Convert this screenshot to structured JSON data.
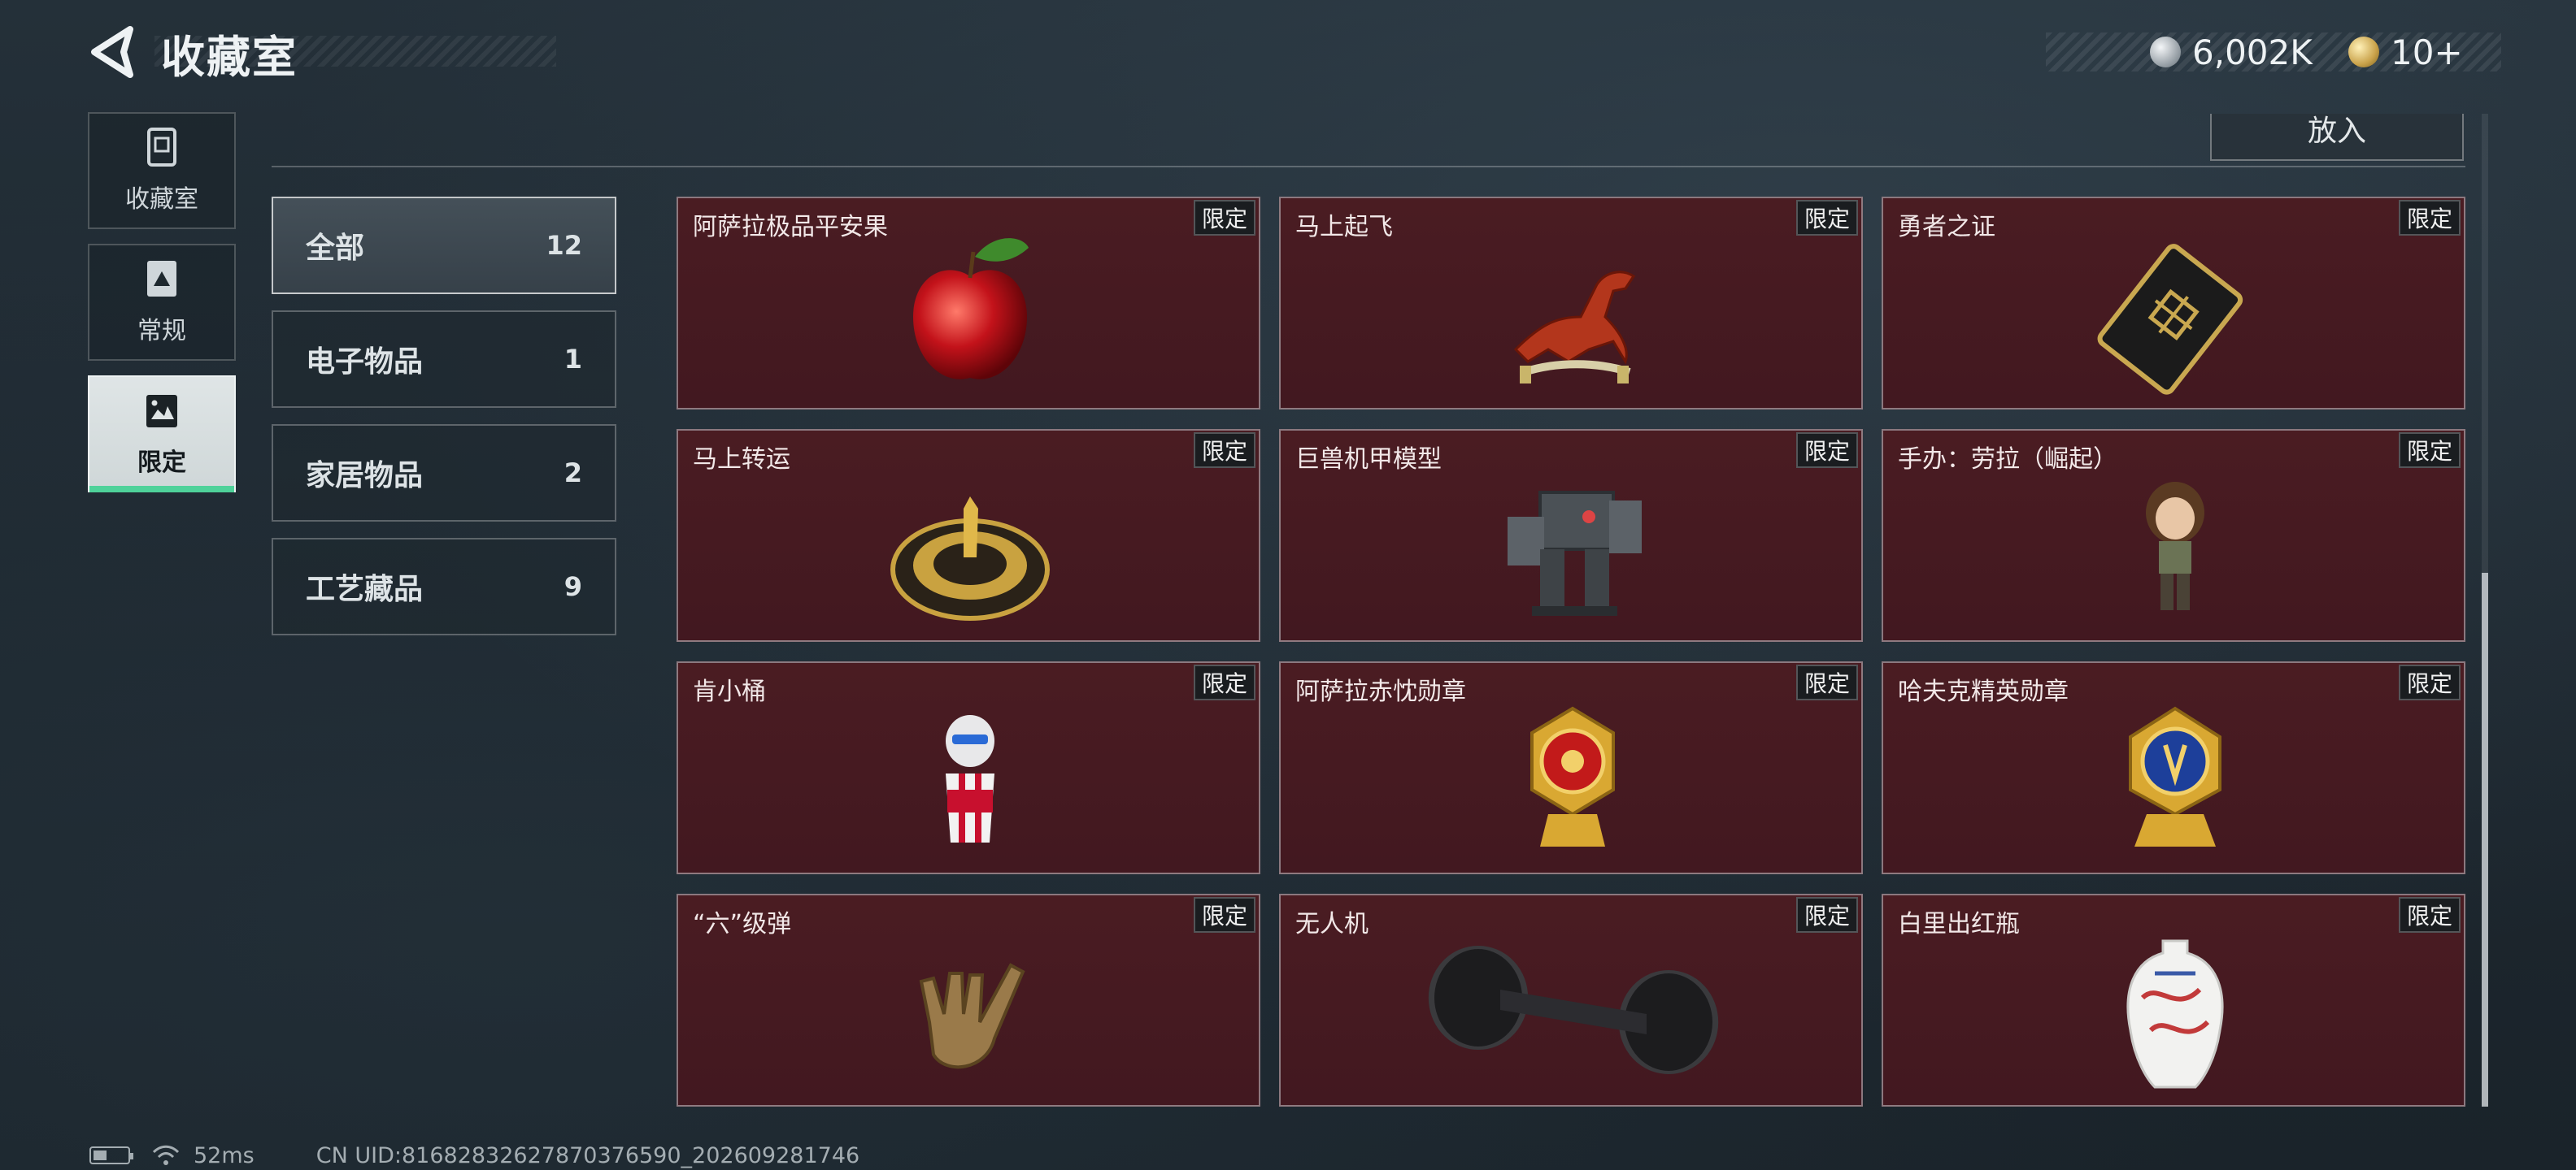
{
  "header": {
    "title": "收藏室",
    "currencies": [
      {
        "icon": "silver-coin-icon",
        "value": "6,002K"
      },
      {
        "icon": "gold-coin-icon",
        "value": "10+"
      }
    ]
  },
  "sidebar": {
    "tabs": [
      {
        "label": "收藏室",
        "icon": "collection-icon",
        "active": false
      },
      {
        "label": "常规",
        "icon": "regular-icon",
        "active": false
      },
      {
        "label": "限定",
        "icon": "limited-icon",
        "active": true
      }
    ]
  },
  "toolbar": {
    "put_label": "放入"
  },
  "categories": [
    {
      "label": "全部",
      "count": "12",
      "active": true
    },
    {
      "label": "电子物品",
      "count": "1",
      "active": false
    },
    {
      "label": "家居物品",
      "count": "2",
      "active": false
    },
    {
      "label": "工艺藏品",
      "count": "9",
      "active": false
    }
  ],
  "items": [
    {
      "name": "阿萨拉极品平安果",
      "badge": "限定",
      "icon": "apple-icon"
    },
    {
      "name": "马上起飞",
      "badge": "限定",
      "icon": "horse-icon"
    },
    {
      "name": "勇者之证",
      "badge": "限定",
      "icon": "card-icon"
    },
    {
      "name": "马上转运",
      "badge": "限定",
      "icon": "compass-icon"
    },
    {
      "name": "巨兽机甲模型",
      "badge": "限定",
      "icon": "mech-icon"
    },
    {
      "name": "手办：劳拉（崛起）",
      "badge": "限定",
      "icon": "figure-icon"
    },
    {
      "name": "肯小桶",
      "badge": "限定",
      "icon": "bucket-figure-icon"
    },
    {
      "name": "阿萨拉赤忱勋章",
      "badge": "限定",
      "icon": "red-medal-icon"
    },
    {
      "name": "哈夫克精英勋章",
      "badge": "限定",
      "icon": "blue-medal-icon"
    },
    {
      "name": "“六”级弹",
      "badge": "限定",
      "icon": "hand-sign-icon"
    },
    {
      "name": "无人机",
      "badge": "限定",
      "icon": "drone-icon"
    },
    {
      "name": "白里出红瓶",
      "badge": "限定",
      "icon": "vase-icon"
    }
  ],
  "status": {
    "ping": "52ms",
    "uid": "CN UID:8168283262787037659​0_202609281746"
  },
  "colors": {
    "card_bg": "#4a1c22",
    "accent": "#4fd29a"
  }
}
